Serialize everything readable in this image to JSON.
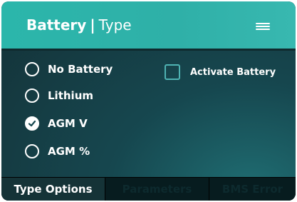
{
  "header": {
    "title_bold": "Battery",
    "separator": "|",
    "title_light": "Type",
    "menu_icon": "hamburger-menu-icon"
  },
  "options": [
    {
      "label": "No Battery",
      "checked": false
    },
    {
      "label": "Lithium",
      "checked": false
    },
    {
      "label": "AGM V",
      "checked": true
    },
    {
      "label": "AGM %",
      "checked": false
    }
  ],
  "activate": {
    "label": "Activate Battery",
    "checked": false
  },
  "tabs": [
    {
      "label": "Type Options",
      "active": true
    },
    {
      "label": "Parameters",
      "active": false
    },
    {
      "label": "BMS Error",
      "active": false
    }
  ],
  "colors": {
    "header": "#2bb6ab",
    "background": "#16474f",
    "tab_active": "#153337",
    "tab_inactive": "#071c1f",
    "checkbox_border": "#4fb3b3"
  }
}
